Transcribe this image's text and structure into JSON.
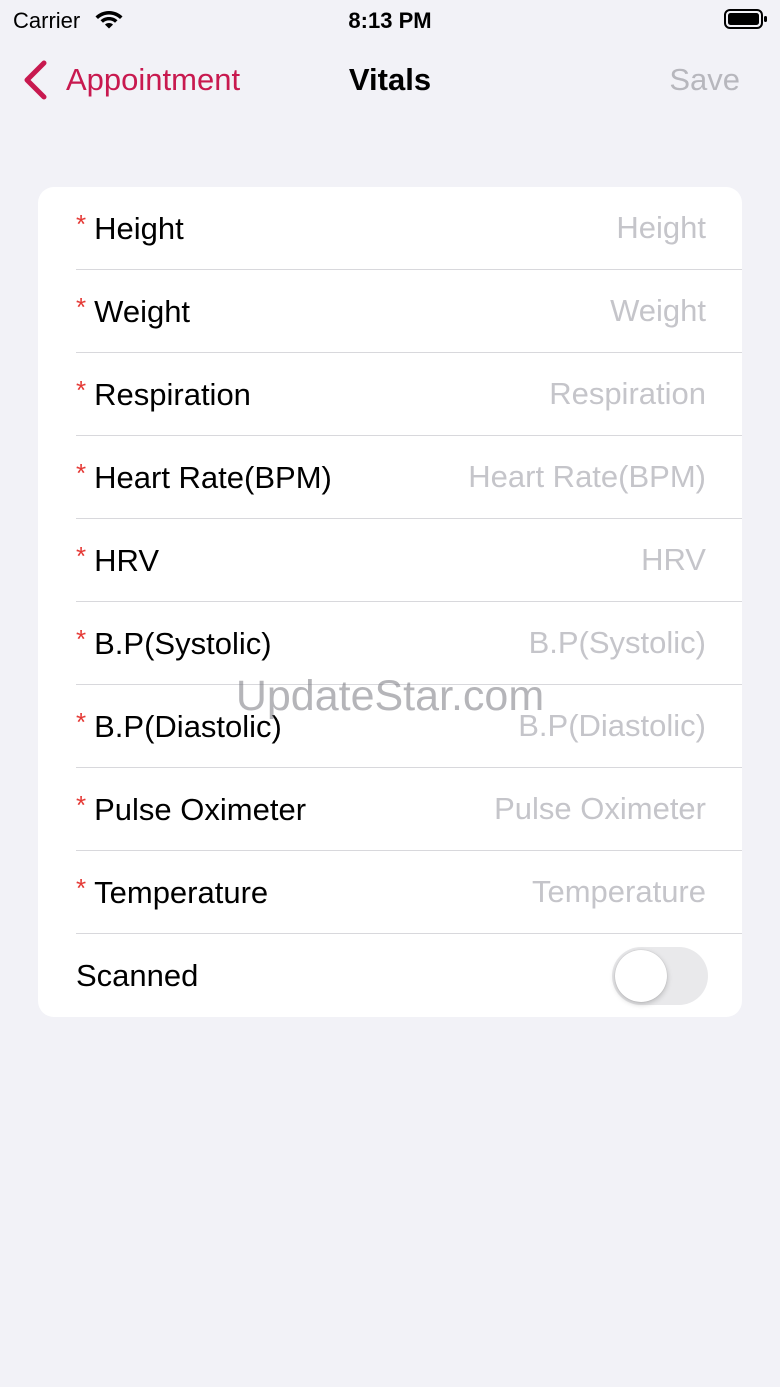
{
  "status_bar": {
    "carrier": "Carrier",
    "time": "8:13 PM"
  },
  "nav": {
    "back_label": "Appointment",
    "title": "Vitals",
    "save_label": "Save"
  },
  "form": {
    "rows": [
      {
        "label": "Height",
        "placeholder": "Height",
        "required": "*"
      },
      {
        "label": "Weight",
        "placeholder": "Weight",
        "required": "*"
      },
      {
        "label": "Respiration",
        "placeholder": "Respiration",
        "required": "*"
      },
      {
        "label": "Heart Rate(BPM)",
        "placeholder": "Heart Rate(BPM)",
        "required": "*"
      },
      {
        "label": "HRV",
        "placeholder": "HRV",
        "required": "*"
      },
      {
        "label": "B.P(Systolic)",
        "placeholder": "B.P(Systolic)",
        "required": "*"
      },
      {
        "label": "B.P(Diastolic)",
        "placeholder": "B.P(Diastolic)",
        "required": "*"
      },
      {
        "label": "Pulse Oximeter",
        "placeholder": "Pulse Oximeter",
        "required": "*"
      },
      {
        "label": "Temperature",
        "placeholder": "Temperature",
        "required": "*"
      }
    ],
    "scanned": {
      "label": "Scanned",
      "on": false
    }
  },
  "watermark": "UpdateStar.com",
  "colors": {
    "accent": "#c8194f",
    "required": "#e53935",
    "placeholder": "#c5c5ca",
    "background": "#f2f2f7"
  },
  "icons": {
    "back": "chevron-left-icon",
    "wifi": "wifi-icon",
    "battery": "battery-icon"
  }
}
